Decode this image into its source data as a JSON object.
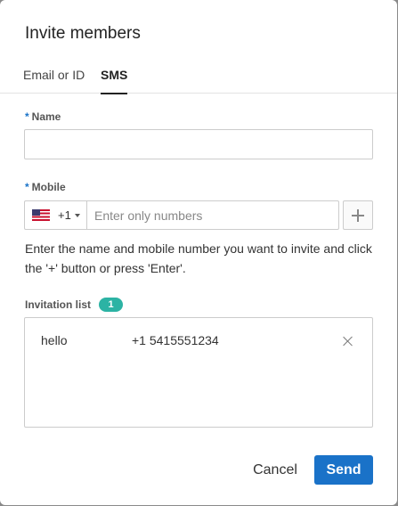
{
  "dialog": {
    "title": "Invite members"
  },
  "tabs": [
    {
      "label": "Email or ID",
      "active": false
    },
    {
      "label": "SMS",
      "active": true
    }
  ],
  "form": {
    "required_marker": "*",
    "name_label": "Name",
    "name_value": "",
    "mobile_label": "Mobile",
    "country_code": "+1",
    "country_flag": "us-flag-icon",
    "phone_placeholder": "Enter only numbers",
    "helper_text": "Enter the name and mobile number you want to invite and click the '+' button or press 'Enter'."
  },
  "invitation_list": {
    "label": "Invitation list",
    "count": "1",
    "items": [
      {
        "name": "hello",
        "phone": "+1 5415551234"
      }
    ]
  },
  "actions": {
    "cancel_label": "Cancel",
    "send_label": "Send"
  },
  "colors": {
    "accent": "#1a72c8",
    "badge": "#2cb3a4"
  }
}
